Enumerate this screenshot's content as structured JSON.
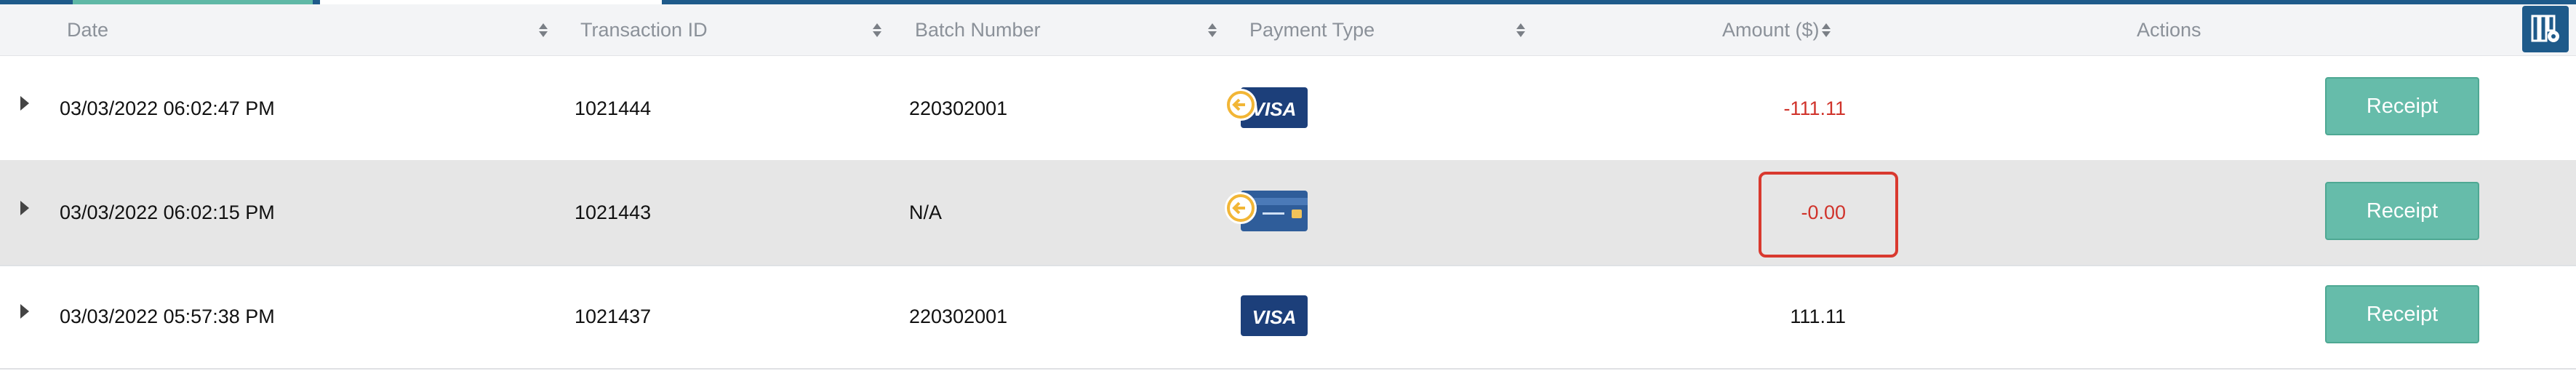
{
  "table": {
    "columns": [
      {
        "label": "Date",
        "sortable": true
      },
      {
        "label": "Transaction ID",
        "sortable": true
      },
      {
        "label": "Batch Number",
        "sortable": true
      },
      {
        "label": "Payment Type",
        "sortable": true
      },
      {
        "label": "Amount ($)",
        "sortable": true
      },
      {
        "label": "Actions",
        "sortable": false
      }
    ],
    "rows": [
      {
        "date": "03/03/2022 06:02:47 PM",
        "transaction_id": "1021444",
        "batch_number": "220302001",
        "payment_type_icon": "visa-card-refund-icon",
        "amount": "-111.11",
        "amount_color": "#d0332b",
        "action_label": "Receipt"
      },
      {
        "date": "03/03/2022 06:02:15 PM",
        "transaction_id": "1021443",
        "batch_number": "N/A",
        "payment_type_icon": "credit-card-refund-icon",
        "amount": "-0.00",
        "amount_color": "#d0332b",
        "action_label": "Receipt"
      },
      {
        "date": "03/03/2022 05:57:38 PM",
        "transaction_id": "1021437",
        "batch_number": "220302001",
        "payment_type_icon": "visa-card-icon",
        "amount": "111.11",
        "amount_color": "#111111",
        "action_label": "Receipt"
      }
    ],
    "highlighted_cell": "rows.1.amount"
  },
  "toolbar": {
    "column_picker_icon": "column-settings-icon"
  },
  "colors": {
    "header_bg": "#f3f4f6",
    "brand_blue": "#1e5a8a",
    "button_green": "#66bcaa",
    "negative_red": "#d0332b",
    "highlight_red": "#d9392f",
    "shaded_row": "#e6e6e6"
  }
}
